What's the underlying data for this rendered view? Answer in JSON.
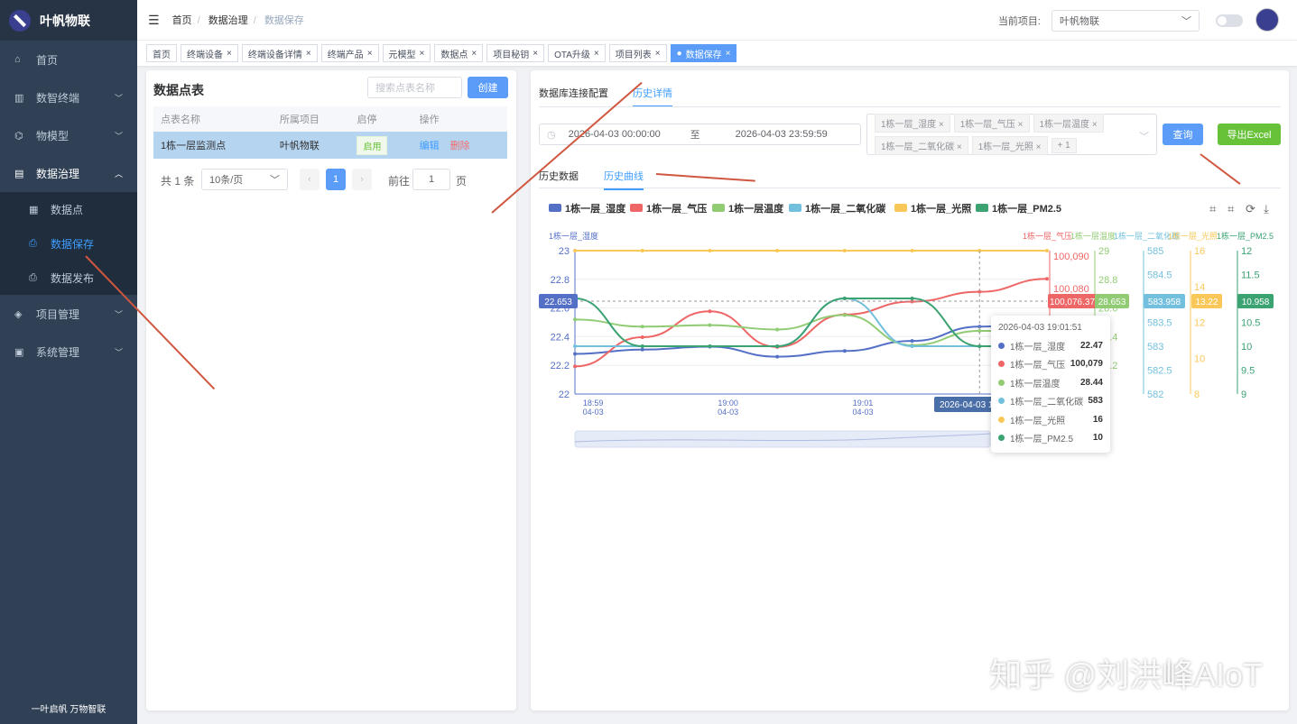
{
  "app": {
    "name": "叶帆物联",
    "slogan": "一叶启帆 万物智联"
  },
  "sidebar": {
    "items": [
      {
        "label": "首页",
        "icon": "home-icon"
      },
      {
        "label": "数智终端",
        "icon": "terminal-icon"
      },
      {
        "label": "物模型",
        "icon": "model-icon"
      },
      {
        "label": "数据治理",
        "icon": "document-icon"
      },
      {
        "label": "项目管理",
        "icon": "project-icon"
      },
      {
        "label": "系统管理",
        "icon": "system-icon"
      }
    ],
    "subitems": [
      {
        "label": "数据点"
      },
      {
        "label": "数据保存"
      },
      {
        "label": "数据发布"
      }
    ]
  },
  "header": {
    "breadcrumb": [
      "首页",
      "数据治理",
      "数据保存"
    ],
    "project_label": "当前项目:",
    "project_value": "叶帆物联"
  },
  "tags": [
    "首页",
    "终端设备",
    "终端设备详情",
    "终端产品",
    "元模型",
    "数据点",
    "项目秘钥",
    "OTA升级",
    "项目列表",
    "数据保存"
  ],
  "left": {
    "title": "数据点表",
    "search_placeholder": "搜索点表名称",
    "create": "创建",
    "columns": [
      "点表名称",
      "所属项目",
      "启停",
      "操作"
    ],
    "rows": [
      {
        "name": "1栋一层监测点",
        "project": "叶帆物联",
        "status": "启用",
        "edit": "编辑",
        "delete": "删除"
      }
    ],
    "pagination": {
      "total": "共 1 条",
      "page_size": "10条/页",
      "page": "1",
      "goto": "前往",
      "goto_value": "1",
      "page_unit": "页"
    }
  },
  "right": {
    "tabs": [
      "数据库连接配置",
      "历史详情"
    ],
    "start": "2026-04-03 00:00:00",
    "to": "至",
    "end": "2026-04-03 23:59:59",
    "selected": [
      "1栋一层_湿度",
      "1栋一层_气压",
      "1栋一层温度",
      "1栋一层_二氧化碳",
      "1栋一层_光照",
      "+ 1"
    ],
    "query": "查询",
    "export": "导出Excel",
    "subtabs": [
      "历史数据",
      "历史曲线"
    ]
  },
  "chart_data": {
    "type": "line",
    "x": [
      "18:58:51",
      "18:59:21",
      "18:59:51",
      "19:00:21",
      "19:00:51",
      "19:01:21",
      "19:01:51",
      "19:02:21"
    ],
    "xticks": [
      {
        "t": "18:59",
        "d": "04-03",
        "idx": 0.27
      },
      {
        "t": "19:00",
        "d": "04-03",
        "idx": 2.27
      },
      {
        "t": "19:01",
        "d": "04-03",
        "idx": 4.27
      }
    ],
    "series": [
      {
        "name": "1栋一层_湿度",
        "color": "#5470c6",
        "ylim": [
          22,
          23
        ],
        "ticks": [
          "22",
          "22.2",
          "22.4",
          "22.6",
          "22.8",
          "23"
        ],
        "values": [
          22.28,
          22.31,
          22.33,
          22.26,
          22.3,
          22.37,
          22.47,
          22.5
        ]
      },
      {
        "name": "1栋一层_气压",
        "color": "#ee6666",
        "ylim": [
          100047.5,
          100091.7
        ],
        "ticks": [
          "100,080",
          "100,090"
        ],
        "values": [
          100056,
          100065,
          100073,
          100062,
          100072,
          100076,
          100079,
          100083
        ]
      },
      {
        "name": "1栋一层温度",
        "color": "#91cc75",
        "ylim": [
          28,
          29
        ],
        "ticks": [
          "28.2",
          "28.4",
          "28.6",
          "28.8",
          "29"
        ],
        "values": [
          28.52,
          28.47,
          28.48,
          28.45,
          28.55,
          28.34,
          28.44,
          28.44
        ]
      },
      {
        "name": "1栋一层_二氧化碳",
        "color": "#73c0de",
        "ylim": [
          582,
          585
        ],
        "ticks": [
          "582",
          "582.5",
          "583",
          "583.5",
          "584",
          "584.5",
          "585"
        ],
        "values": [
          583,
          583,
          583,
          583,
          584,
          583,
          583,
          583
        ]
      },
      {
        "name": "1栋一层_光照",
        "color": "#fac858",
        "ylim": [
          8,
          16
        ],
        "ticks": [
          "8",
          "10",
          "12",
          "14",
          "16"
        ],
        "values": [
          16,
          16,
          16,
          16,
          16,
          16,
          16,
          16
        ]
      },
      {
        "name": "1栋一层_PM2.5",
        "color": "#3ba272",
        "ylim": [
          9,
          12
        ],
        "ticks": [
          "9",
          "9.5",
          "10",
          "10.5",
          "11",
          "11.5",
          "12"
        ],
        "values": [
          11,
          10,
          10,
          10,
          11,
          11,
          10,
          10
        ]
      }
    ],
    "pointer": {
      "x_label": "2026-04-03 19:01:51",
      "y_labels": [
        "22.653",
        "100,076.37",
        "28.653",
        "583.958",
        "13.22",
        "10.958"
      ]
    },
    "tooltip": {
      "title": "2026-04-03 19:01:51",
      "values": [
        "22.47",
        "100,079",
        "28.44",
        "583",
        "16",
        "10"
      ]
    }
  },
  "watermark": "知乎 @刘洪峰AIoT"
}
